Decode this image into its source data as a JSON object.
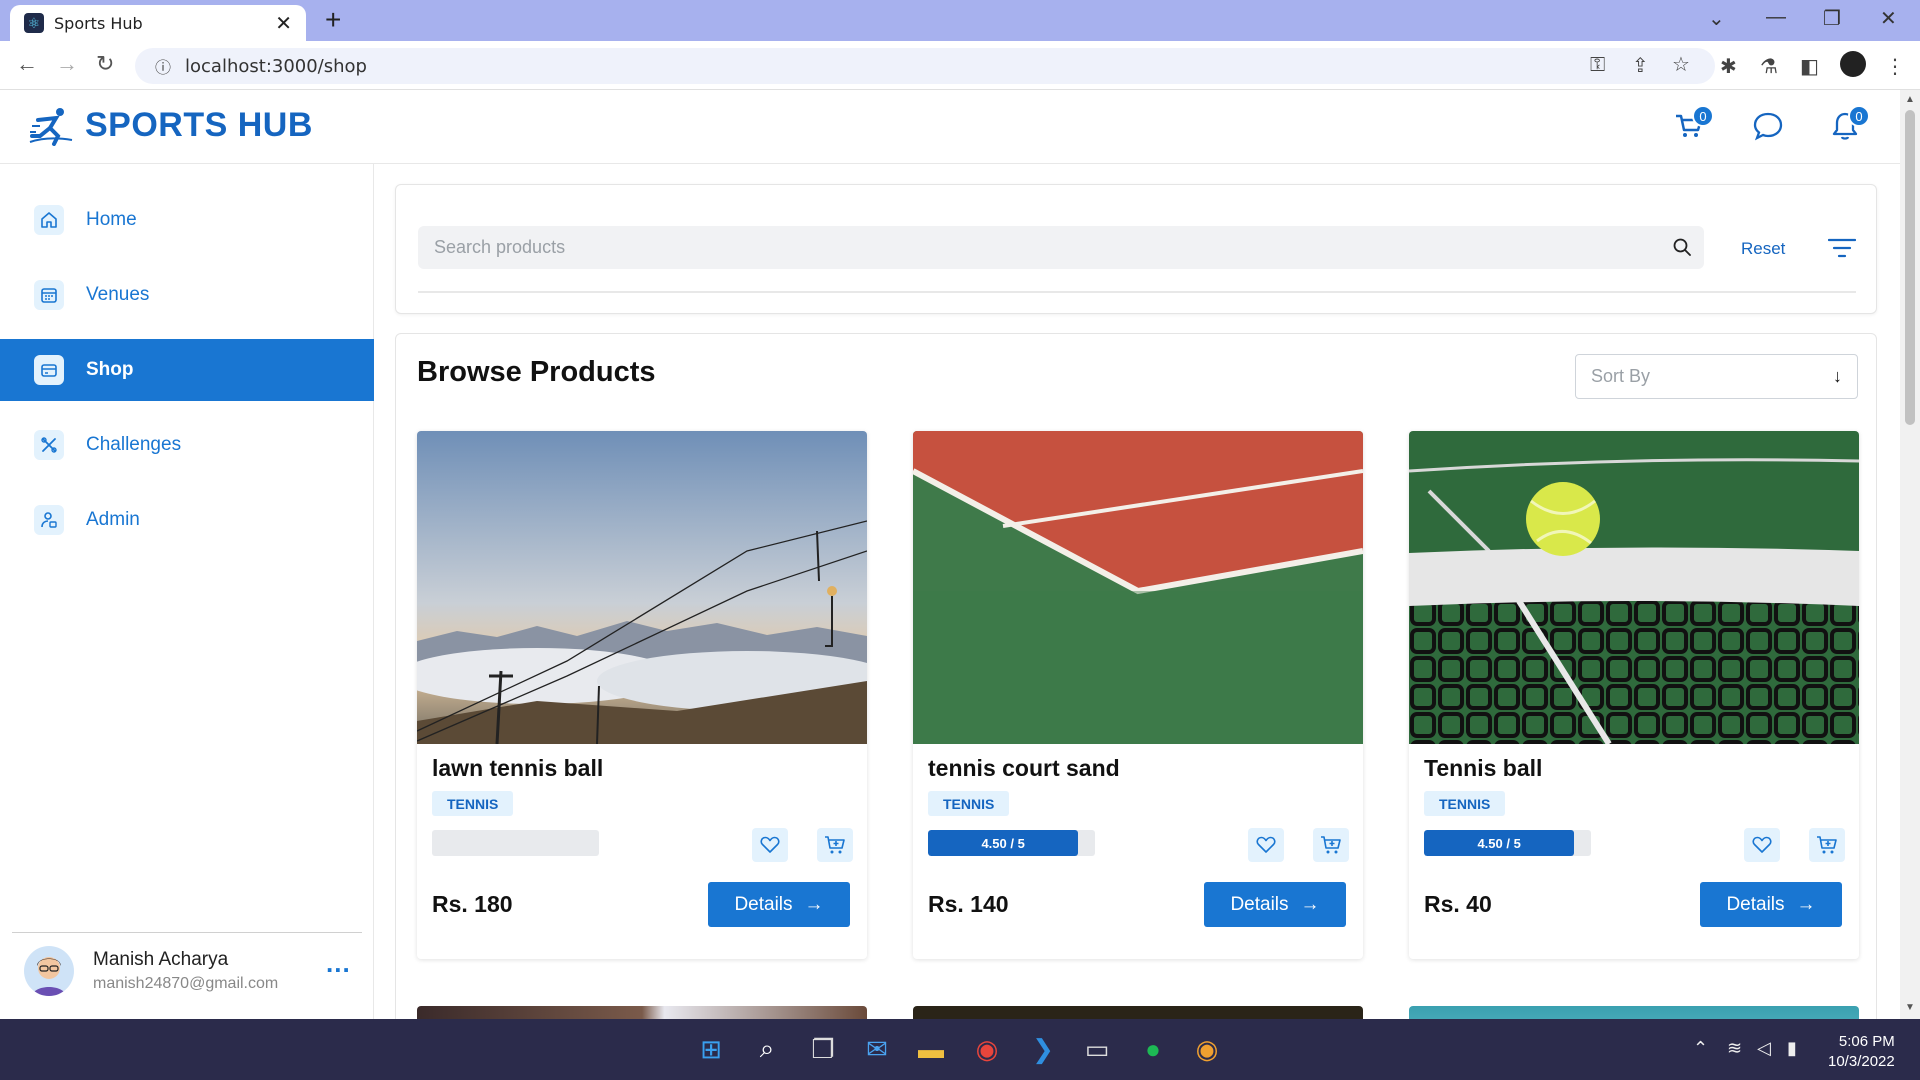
{
  "browser": {
    "tab_title": "Sports Hub",
    "url": "localhost:3000/shop"
  },
  "header": {
    "logo_text": "SPORTS HUB",
    "cart_count": "0",
    "notification_count": "0"
  },
  "sidebar": {
    "items": [
      {
        "label": "Home",
        "icon": "home-icon",
        "active": false
      },
      {
        "label": "Venues",
        "icon": "calendar-icon",
        "active": false
      },
      {
        "label": "Shop",
        "icon": "card-icon",
        "active": true
      },
      {
        "label": "Challenges",
        "icon": "tools-icon",
        "active": false
      },
      {
        "label": "Admin",
        "icon": "user-lock-icon",
        "active": false
      }
    ],
    "user": {
      "name": "Manish Acharya",
      "email": "manish24870@gmail.com",
      "more": "..."
    }
  },
  "search": {
    "placeholder": "Search products",
    "reset_label": "Reset"
  },
  "products_section": {
    "title": "Browse Products",
    "sort_placeholder": "Sort By"
  },
  "products": [
    {
      "name": "lawn tennis ball",
      "tag": "TENNIS",
      "rating_text": "",
      "rating": 0,
      "price": "Rs. 180",
      "details_label": "Details"
    },
    {
      "name": "tennis court sand",
      "tag": "TENNIS",
      "rating_text": "4.50 / 5",
      "rating": 4.5,
      "price": "Rs. 140",
      "details_label": "Details"
    },
    {
      "name": "Tennis ball",
      "tag": "TENNIS",
      "rating_text": "4.50 / 5",
      "rating": 4.5,
      "price": "Rs. 40",
      "details_label": "Details"
    }
  ],
  "taskbar": {
    "time": "5:06 PM",
    "date": "10/3/2022"
  },
  "colors": {
    "primary": "#1976d2",
    "brand": "#1565c0",
    "tag_bg": "#e3f2fd",
    "taskbar": "#2b2b4b"
  }
}
